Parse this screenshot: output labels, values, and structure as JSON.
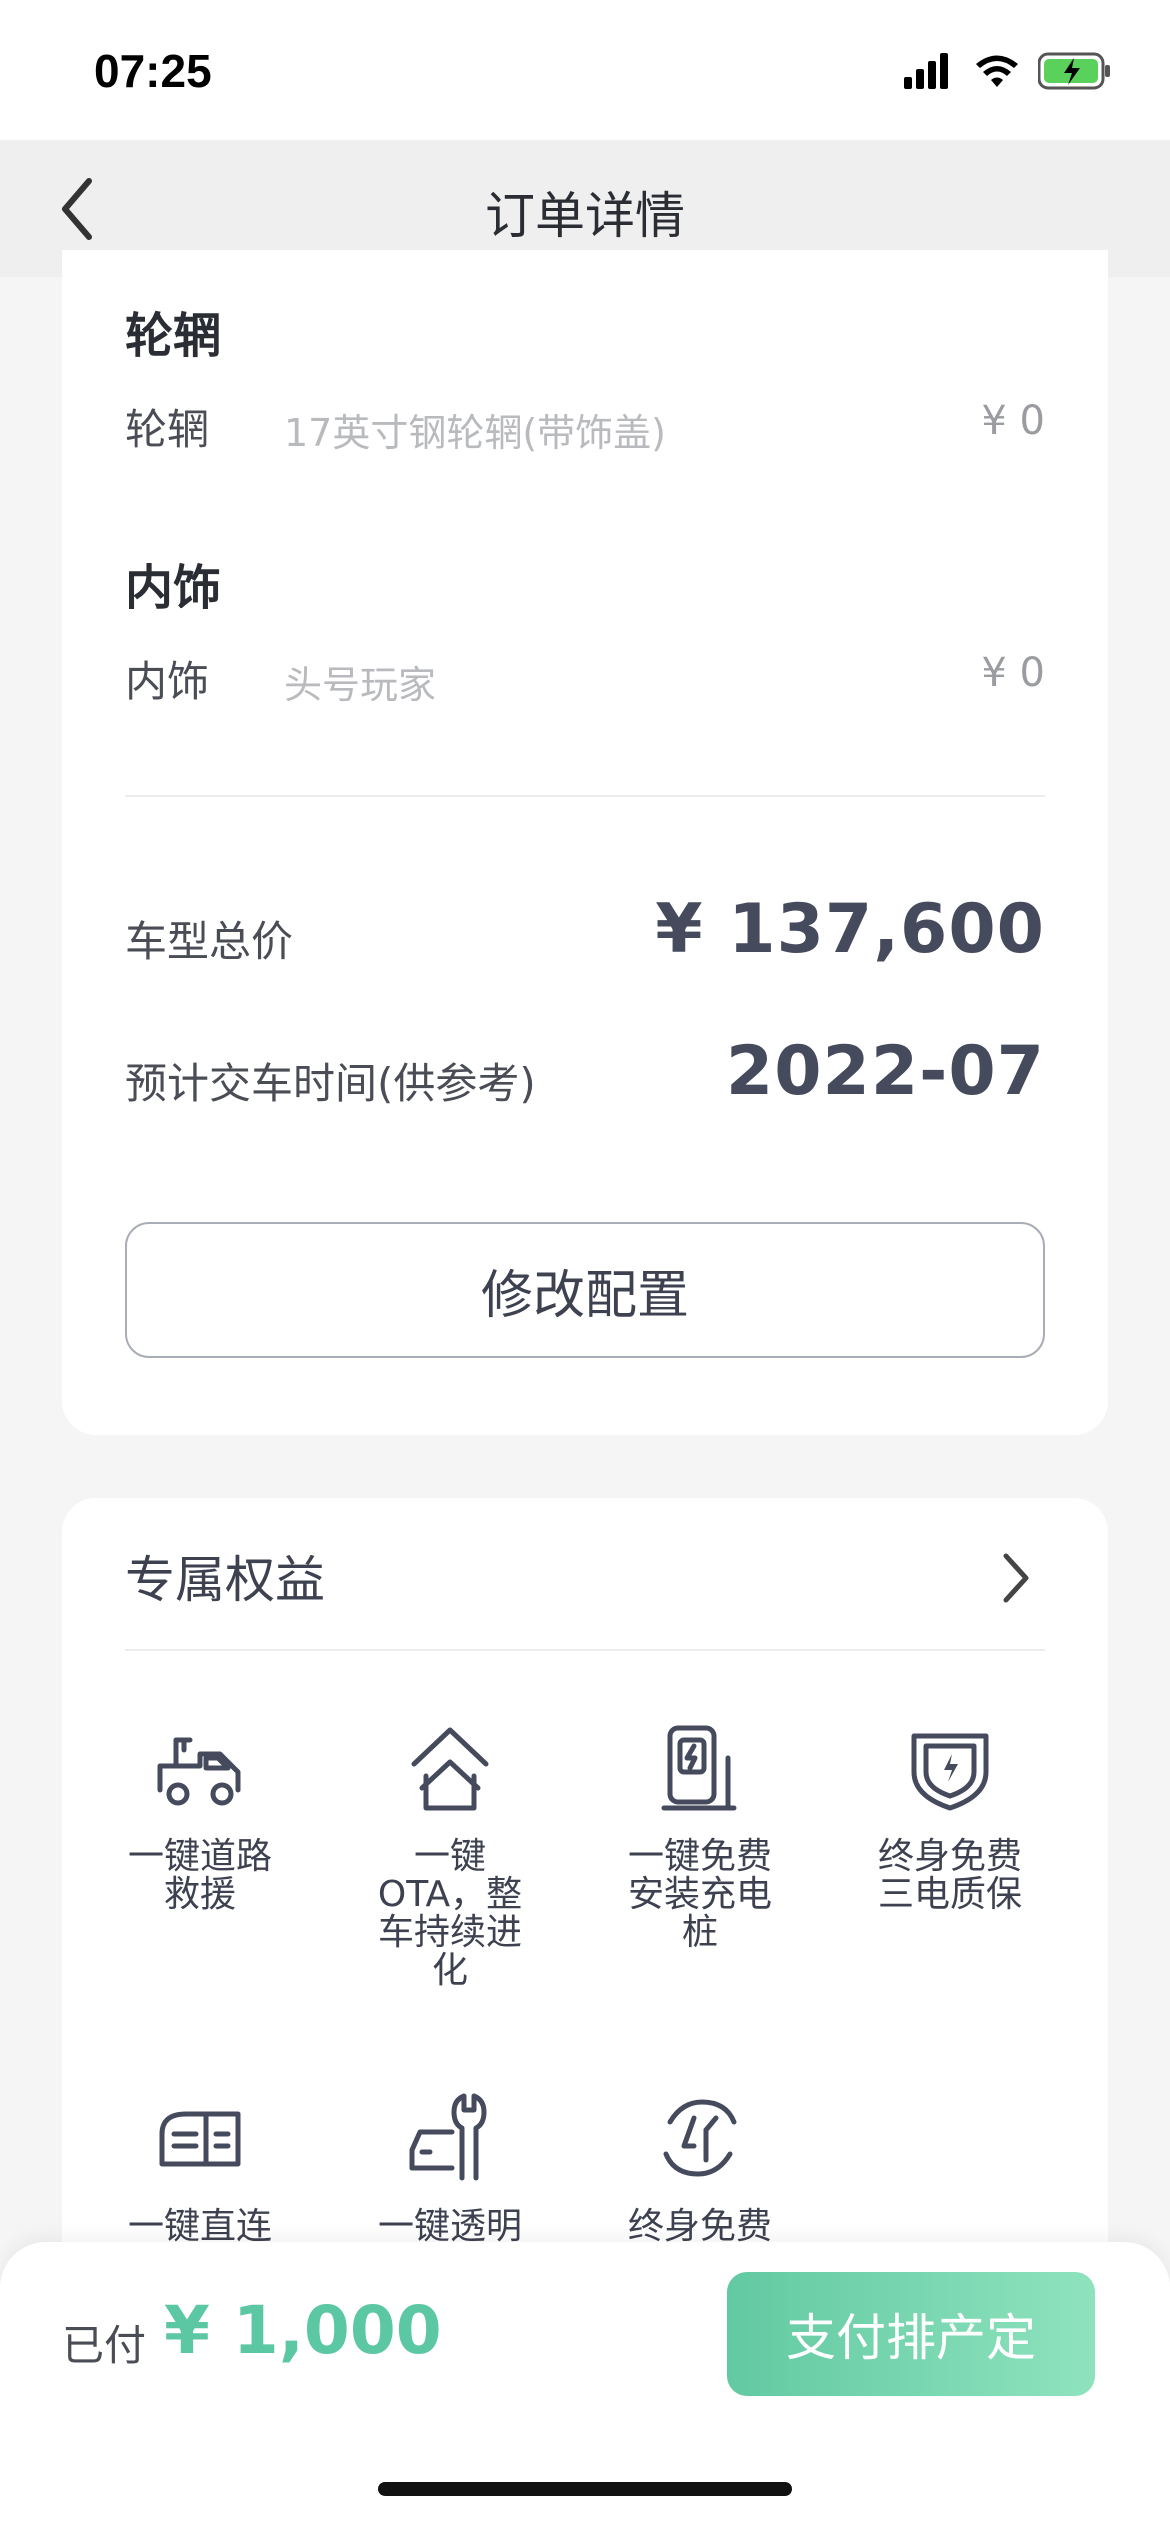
{
  "status": {
    "time": "07:25"
  },
  "nav": {
    "title": "订单详情"
  },
  "config": {
    "wheel": {
      "title": "轮辋",
      "label": "轮辋",
      "value": "17英寸钢轮辋(带饰盖)",
      "price": "¥ 0"
    },
    "interior": {
      "title": "内饰",
      "label": "内饰",
      "value": "头号玩家",
      "price": "¥ 0"
    },
    "total_label": "车型总价",
    "total_value": "¥ 137,600",
    "delivery_label": "预计交车时间(供参考)",
    "delivery_value": "2022-07",
    "modify_button": "修改配置"
  },
  "benefits": {
    "title": "专属权益",
    "items": [
      {
        "label": "一键道路救援",
        "icon": "tow-truck-icon"
      },
      {
        "label": "一键OTA，整车持续进化",
        "icon": "ota-upgrade-icon"
      },
      {
        "label": "一键免费安装充电桩",
        "icon": "charger-icon"
      },
      {
        "label": "终身免费三电质保",
        "icon": "shield-battery-icon"
      },
      {
        "label": "一键直连",
        "icon": "connect-icon"
      },
      {
        "label": "一键透明",
        "icon": "car-wrench-icon"
      },
      {
        "label": "终身免费",
        "icon": "lifetime-icon"
      }
    ]
  },
  "bottom": {
    "paid_label": "已付",
    "paid_value": "¥ 1,000",
    "pay_button": "支付排产定"
  },
  "colors": {
    "accent": "#5cc7a3",
    "dark_text": "#454a5c"
  }
}
